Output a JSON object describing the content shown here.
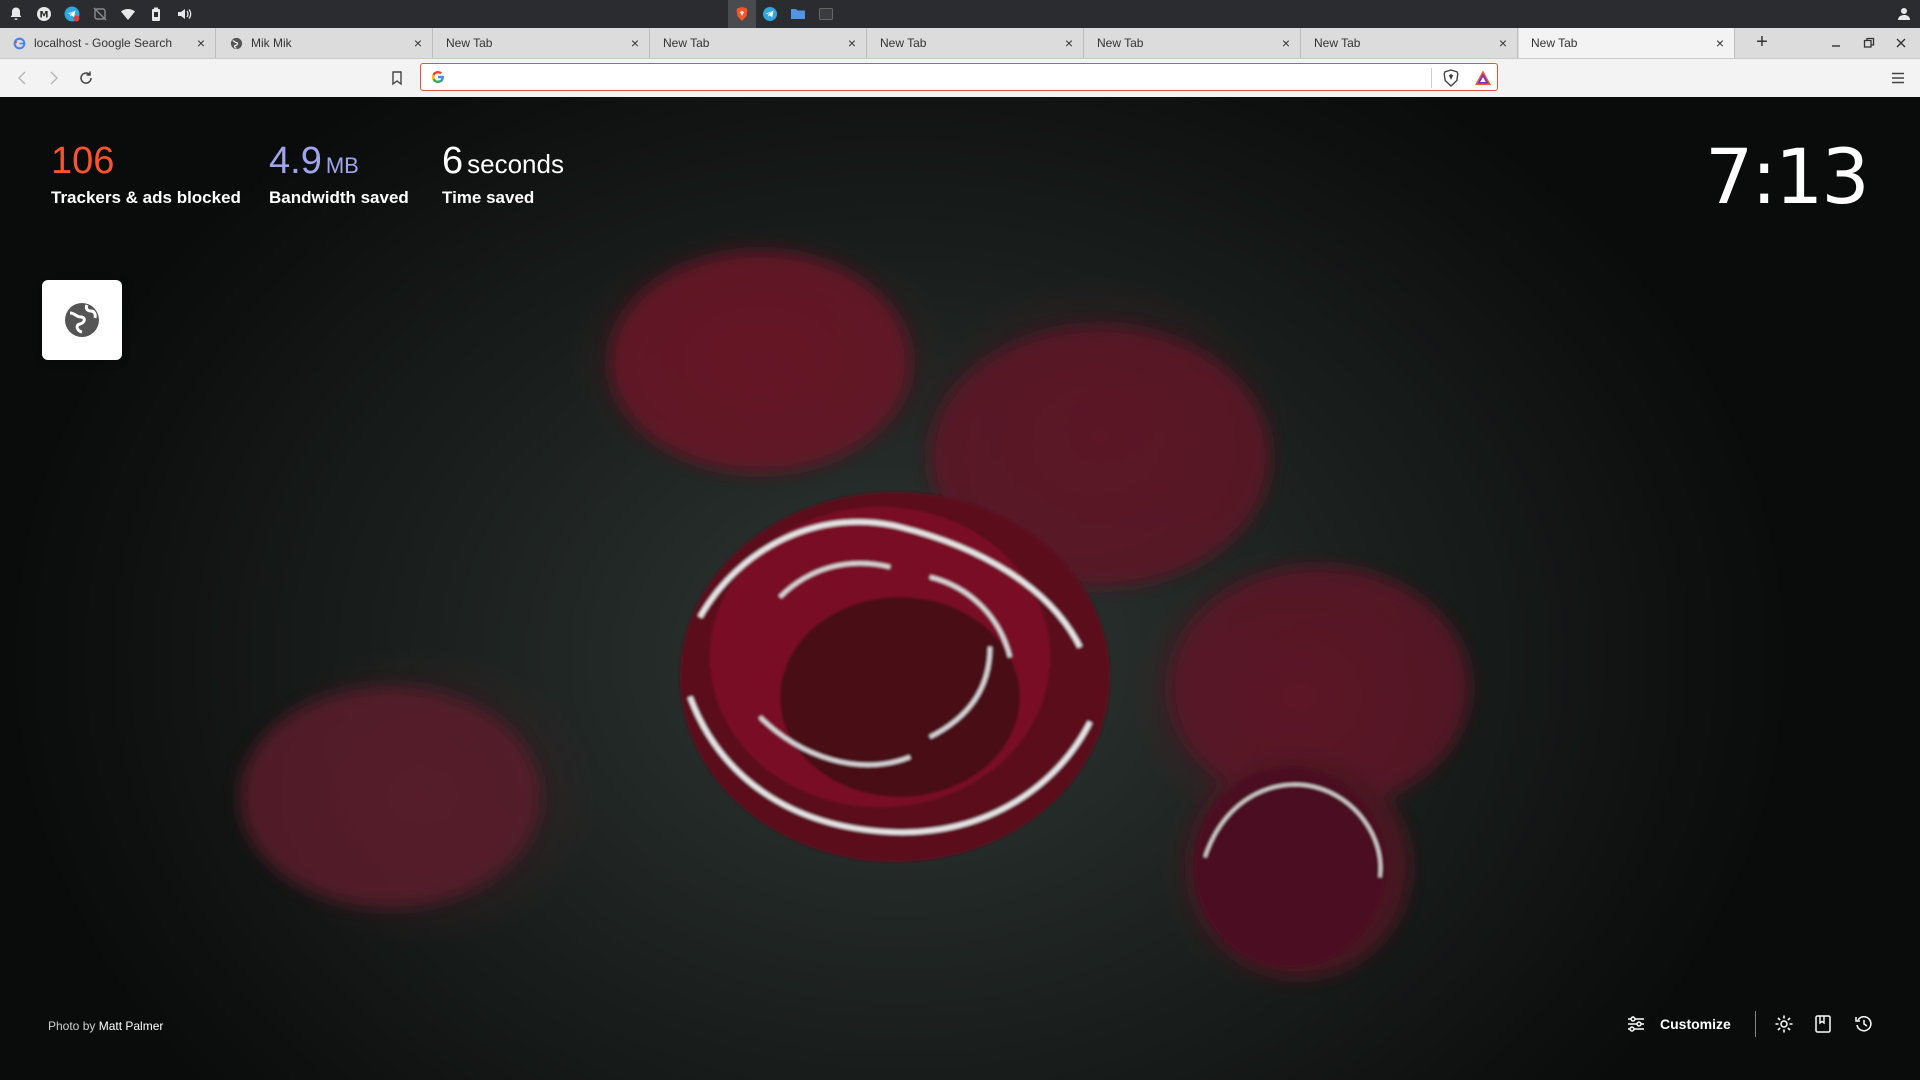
{
  "system_panel": {
    "left_icons": [
      "bell-icon",
      "mail-icon",
      "telegram-icon",
      "no-network-icon",
      "wifi-icon",
      "battery-icon",
      "volume-icon"
    ],
    "center_icons": [
      "brave-icon",
      "telegram-icon",
      "folder-icon",
      "terminal-icon"
    ],
    "right_icons": [
      "user-icon"
    ]
  },
  "tabs": [
    {
      "title": "localhost - Google Search",
      "favicon": "google-icon"
    },
    {
      "title": "Mik Mik",
      "favicon": "globe-icon"
    },
    {
      "title": "New Tab",
      "favicon": ""
    },
    {
      "title": "New Tab",
      "favicon": ""
    },
    {
      "title": "New Tab",
      "favicon": ""
    },
    {
      "title": "New Tab",
      "favicon": ""
    },
    {
      "title": "New Tab",
      "favicon": ""
    },
    {
      "title": "New Tab",
      "favicon": "",
      "active": true
    }
  ],
  "tab_close_glyph": "×",
  "new_tab_glyph": "+",
  "address_bar": {
    "value": "",
    "search_engine_icon": "google-icon"
  },
  "ntp": {
    "stats": [
      {
        "value": "106",
        "unit": "",
        "label": "Trackers & ads blocked",
        "color": "#fb542b"
      },
      {
        "value": "4.9",
        "unit": "MB",
        "label": "Bandwidth saved",
        "color": "#a0a5eb"
      },
      {
        "value": "6",
        "unit": "seconds",
        "label": "Time saved",
        "color": "#ffffff"
      }
    ],
    "clock": "7:13",
    "top_site_icon": "globe-icon",
    "photo_credit_prefix": "Photo by ",
    "photo_credit_author": "Matt Palmer",
    "customize_label": "Customize"
  },
  "colors": {
    "accent": "#fb542b",
    "tabstrip": "#dcdcdc",
    "toolbar": "#f3f3f3"
  }
}
